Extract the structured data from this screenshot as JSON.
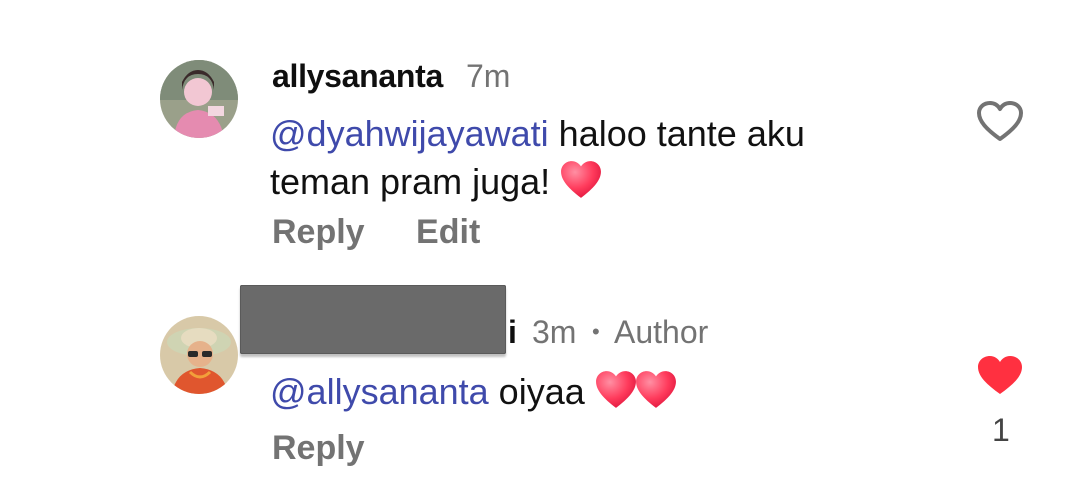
{
  "comments": [
    {
      "username": "allysananta",
      "time": "7m",
      "mention": "@dyahwijayawati",
      "text_line1": " haloo tante aku",
      "text_line2": "teman pram juga! ",
      "emoji": [
        "heart-emoji"
      ],
      "actions": {
        "reply": "Reply",
        "edit": "Edit"
      },
      "like": {
        "icon": "heart-outline-icon",
        "liked": false,
        "count": ""
      }
    },
    {
      "username_suffix": "i",
      "time": "3m",
      "separator": "•",
      "badge": "Author",
      "mention": "@allysananta",
      "text": " oiyaa ",
      "emoji": [
        "heart-emoji",
        "heart-emoji"
      ],
      "actions": {
        "reply": "Reply"
      },
      "like": {
        "icon": "heart-filled-icon",
        "liked": true,
        "count": "1"
      }
    }
  ],
  "colors": {
    "mention": "#3f4aab",
    "meta": "#737373",
    "like_active": "#ff3040"
  }
}
